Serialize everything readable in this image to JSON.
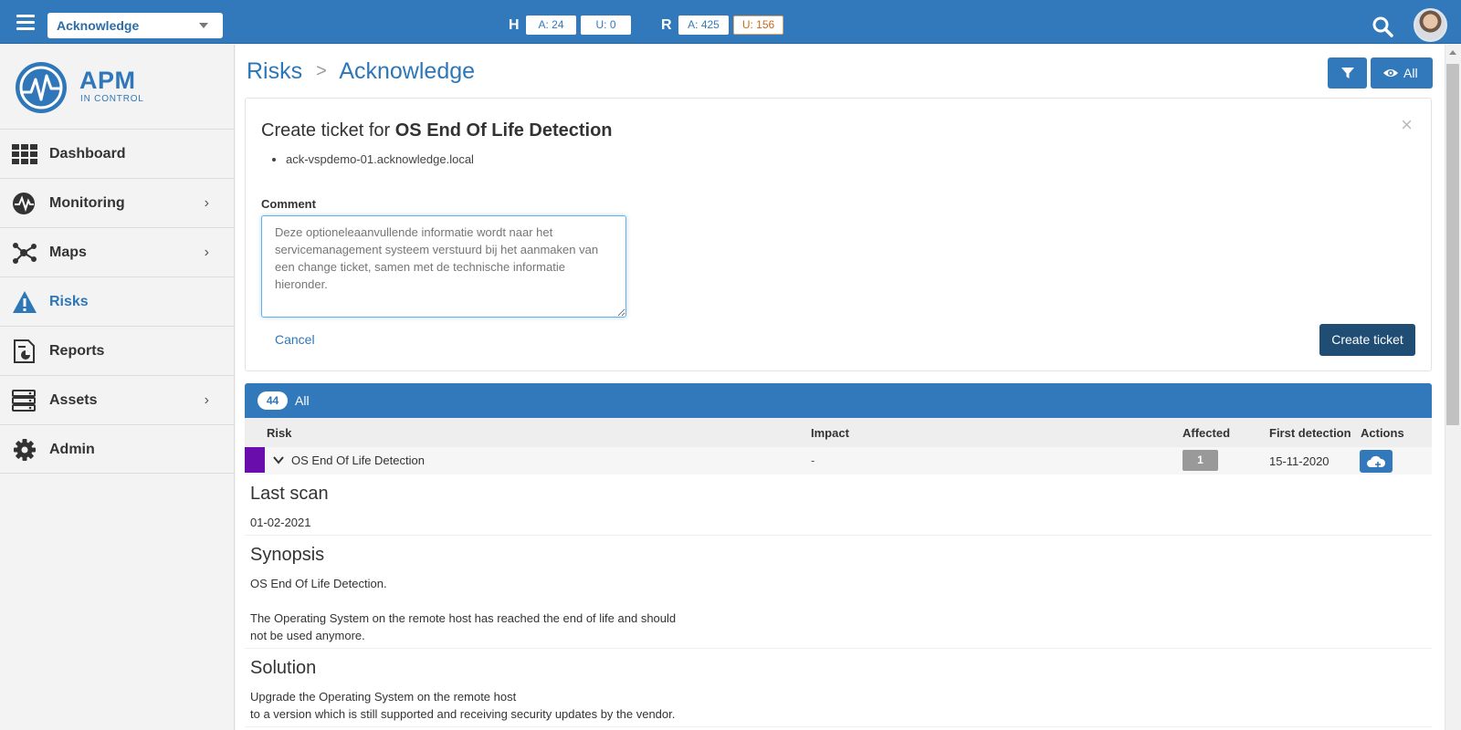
{
  "topbar": {
    "context_select": "Acknowledge",
    "stats": [
      {
        "letter": "H",
        "a": "A: 24",
        "u": "U: 0"
      },
      {
        "letter": "R",
        "a": "A: 425",
        "u": "U: 156"
      }
    ],
    "colors": {
      "bar": "#3279bb",
      "warn": "#c86a1b"
    }
  },
  "sidebar": {
    "logo_text": "APM",
    "logo_sub": "IN CONTROL",
    "items": [
      {
        "label": "Dashboard",
        "icon": "grid-icon",
        "has_chevron": false
      },
      {
        "label": "Monitoring",
        "icon": "pulse-icon",
        "has_chevron": true
      },
      {
        "label": "Maps",
        "icon": "network-icon",
        "has_chevron": true
      },
      {
        "label": "Risks",
        "icon": "warning-icon",
        "has_chevron": false,
        "active": true
      },
      {
        "label": "Reports",
        "icon": "report-icon",
        "has_chevron": false
      },
      {
        "label": "Assets",
        "icon": "server-icon",
        "has_chevron": true
      },
      {
        "label": "Admin",
        "icon": "gear-icon",
        "has_chevron": false
      }
    ]
  },
  "breadcrumb": {
    "parent": "Risks",
    "separator": ">",
    "current": "Acknowledge"
  },
  "toolbar": {
    "all_label": "All"
  },
  "ticket_panel": {
    "title_prefix": "Create ticket for",
    "title_subject": "OS End Of Life Detection",
    "hosts": [
      "ack-vspdemo-01.acknowledge.local"
    ],
    "comment_label": "Comment",
    "comment_placeholder": "Deze optioneleaanvullende informatie wordt naar het servicemanagement systeem verstuurd bij het aanmaken van een change ticket, samen met de technische informatie hieronder.",
    "cancel_label": "Cancel",
    "create_label": "Create ticket",
    "close_symbol": "×"
  },
  "risk_list": {
    "count": "44",
    "filter_label": "All",
    "columns": [
      "Risk",
      "Impact",
      "Affected",
      "First detection",
      "Actions"
    ],
    "rows": [
      {
        "name": "OS End Of Life Detection",
        "impact": "-",
        "affected": "1",
        "first_detection": "15-11-2020",
        "severity_color": "#6a0dad"
      }
    ]
  },
  "details": {
    "last_scan_title": "Last scan",
    "last_scan_value": "01-02-2021",
    "synopsis_title": "Synopsis",
    "synopsis_line1": "OS End Of Life Detection.",
    "synopsis_line2": "The Operating System on the remote host has reached the end of life and should",
    "synopsis_line3": "not be used anymore.",
    "solution_title": "Solution",
    "solution_line1": "Upgrade the Operating System on the remote host",
    "solution_line2": "to a version which is still supported and receiving security updates by the vendor."
  }
}
